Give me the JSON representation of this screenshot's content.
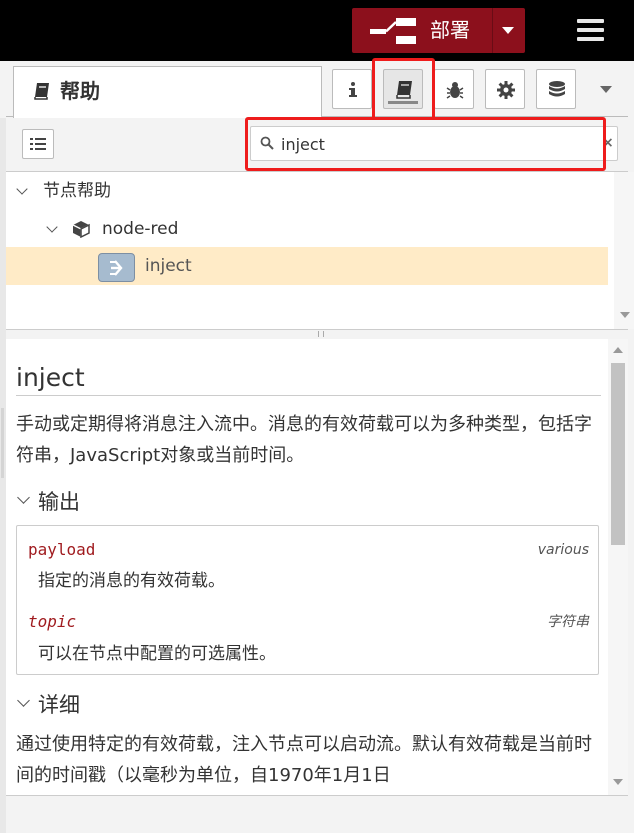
{
  "header": {
    "deploy_label": "部署"
  },
  "sidebar_tabs": {
    "help_label": "帮助",
    "buttons": [
      {
        "name": "info-button",
        "icon": "info-icon"
      },
      {
        "name": "help-button",
        "icon": "book-icon",
        "active": true
      },
      {
        "name": "debug-button",
        "icon": "bug-icon"
      },
      {
        "name": "config-button",
        "icon": "gear-icon"
      },
      {
        "name": "context-button",
        "icon": "database-icon"
      }
    ]
  },
  "search": {
    "value": "inject",
    "clear": "×"
  },
  "tree": {
    "root_label": "节点帮助",
    "module_label": "node-red",
    "node_label": "inject"
  },
  "help": {
    "title": "inject",
    "description": "手动或定期得将消息注入流中。消息的有效荷载可以为多种类型，包括字符串，JavaScript对象或当前时间。",
    "outputs_heading": "输出",
    "properties": [
      {
        "name": "payload",
        "type": "various",
        "desc": "指定的消息的有效荷载。"
      },
      {
        "name": "topic",
        "type": "字符串",
        "desc": "可以在节点中配置的可选属性。"
      }
    ],
    "details_heading": "详细",
    "details_text": "通过使用特定的有效荷载，注入节点可以启动流。默认有效荷载是当前时间的时间戳（以毫秒为单位，自1970年1月1日"
  },
  "colors": {
    "deploy_bg": "#8c101c",
    "highlight": "#ee1c1c",
    "selected_row": "#ffebc7",
    "node_badge": "#a6bbcf",
    "prop_name": "#a01b1f"
  }
}
